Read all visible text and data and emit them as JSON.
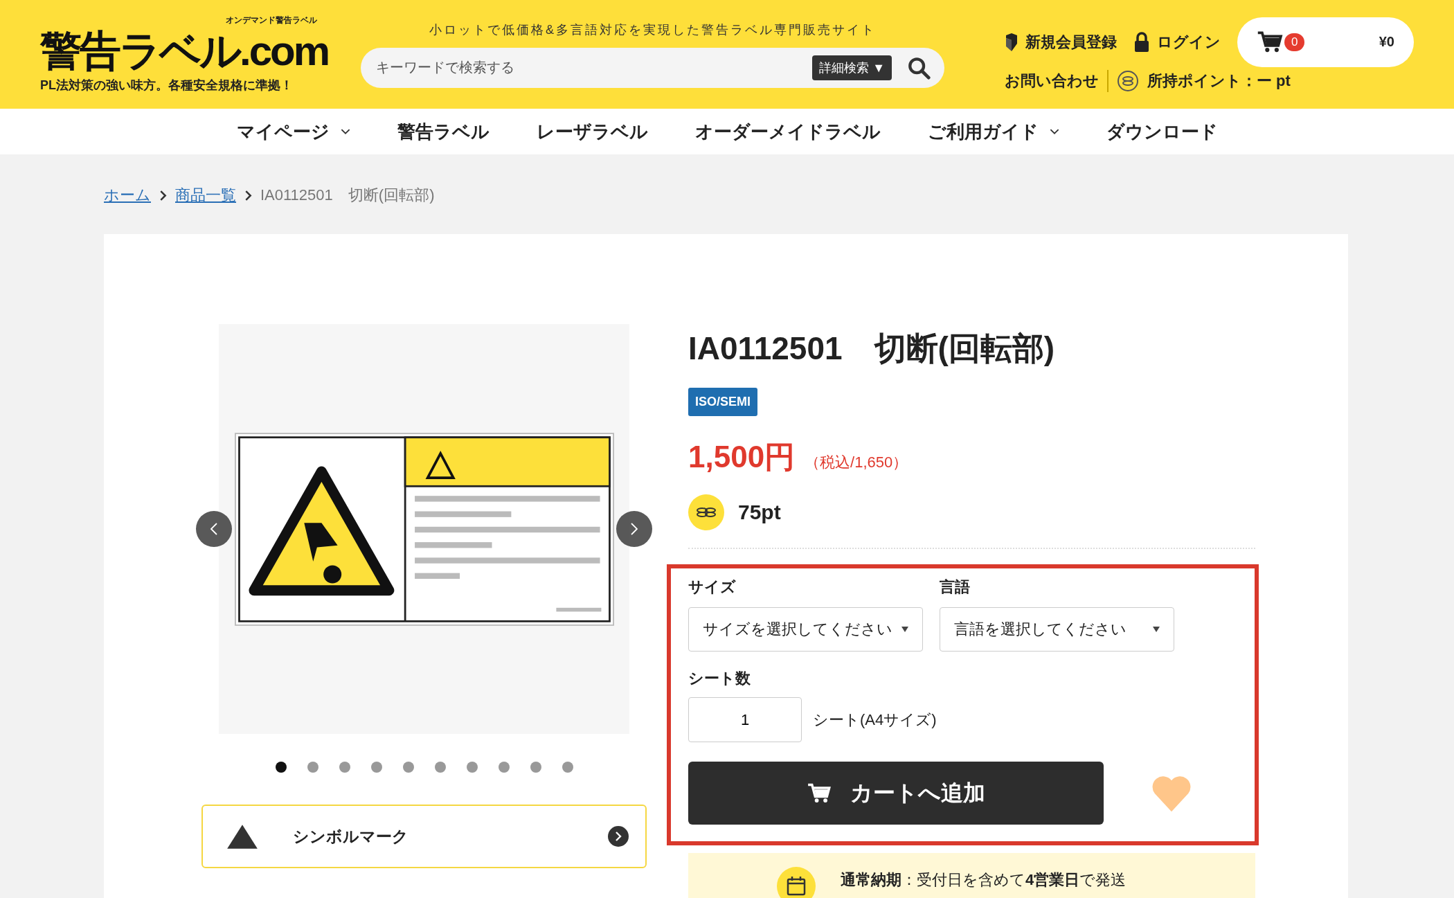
{
  "header": {
    "logo": {
      "caption": "オンデマンド警告ラベル",
      "wordmark": "警告ラベル.com",
      "slogan": "PL法対策の強い味方。各種安全規格に準拠！"
    },
    "catchphrase": "小ロットで低価格&多言語対応を実現した警告ラベル専門販売サイト",
    "search": {
      "placeholder": "キーワードで検索する",
      "advanced_button": "詳細検索 ▼"
    },
    "account_links": [
      {
        "kind": "register",
        "label": "新規会員登録"
      },
      {
        "kind": "login",
        "label": "ログイン"
      }
    ],
    "cart": {
      "count": "0",
      "total": "¥0"
    },
    "contact_link": "お問い合わせ",
    "points": "所持ポイント：ー pt"
  },
  "nav": [
    {
      "label": "マイページ",
      "dropdown": true
    },
    {
      "label": "警告ラベル",
      "dropdown": false
    },
    {
      "label": "レーザラベル",
      "dropdown": false
    },
    {
      "label": "オーダーメイドラベル",
      "dropdown": false
    },
    {
      "label": "ご利用ガイド",
      "dropdown": true
    },
    {
      "label": "ダウンロード",
      "dropdown": false
    }
  ],
  "breadcrumb": [
    {
      "label": "ホーム",
      "link": true
    },
    {
      "label": "商品一覧",
      "link": true
    },
    {
      "label": "IA0112501　切断(回転部)",
      "link": false
    }
  ],
  "product": {
    "gallery": {
      "slides": [
        {
          "selected": true
        },
        {
          "selected": false
        },
        {
          "selected": false
        },
        {
          "selected": false
        },
        {
          "selected": false
        },
        {
          "selected": false
        },
        {
          "selected": false
        },
        {
          "selected": false
        },
        {
          "selected": false
        },
        {
          "selected": false
        }
      ]
    },
    "symbol_mark": "シンボルマーク",
    "title": "IA0112501　切断(回転部)",
    "badge": "ISO/SEMI",
    "price": "1,500円",
    "tax_price": "（税込/1,650）",
    "points": "75pt",
    "options": [
      {
        "label": "サイズ",
        "placeholder": "サイズを選択してください"
      },
      {
        "label": "言語",
        "placeholder": "言語を選択してください"
      }
    ],
    "quantity": {
      "label": "シート数",
      "value": "1",
      "unit": "シート(A4サイズ)"
    },
    "add_to_cart": "カートへ追加",
    "delivery": "**通常納期**：受付日を含めて**4営業日**で発送"
  }
}
